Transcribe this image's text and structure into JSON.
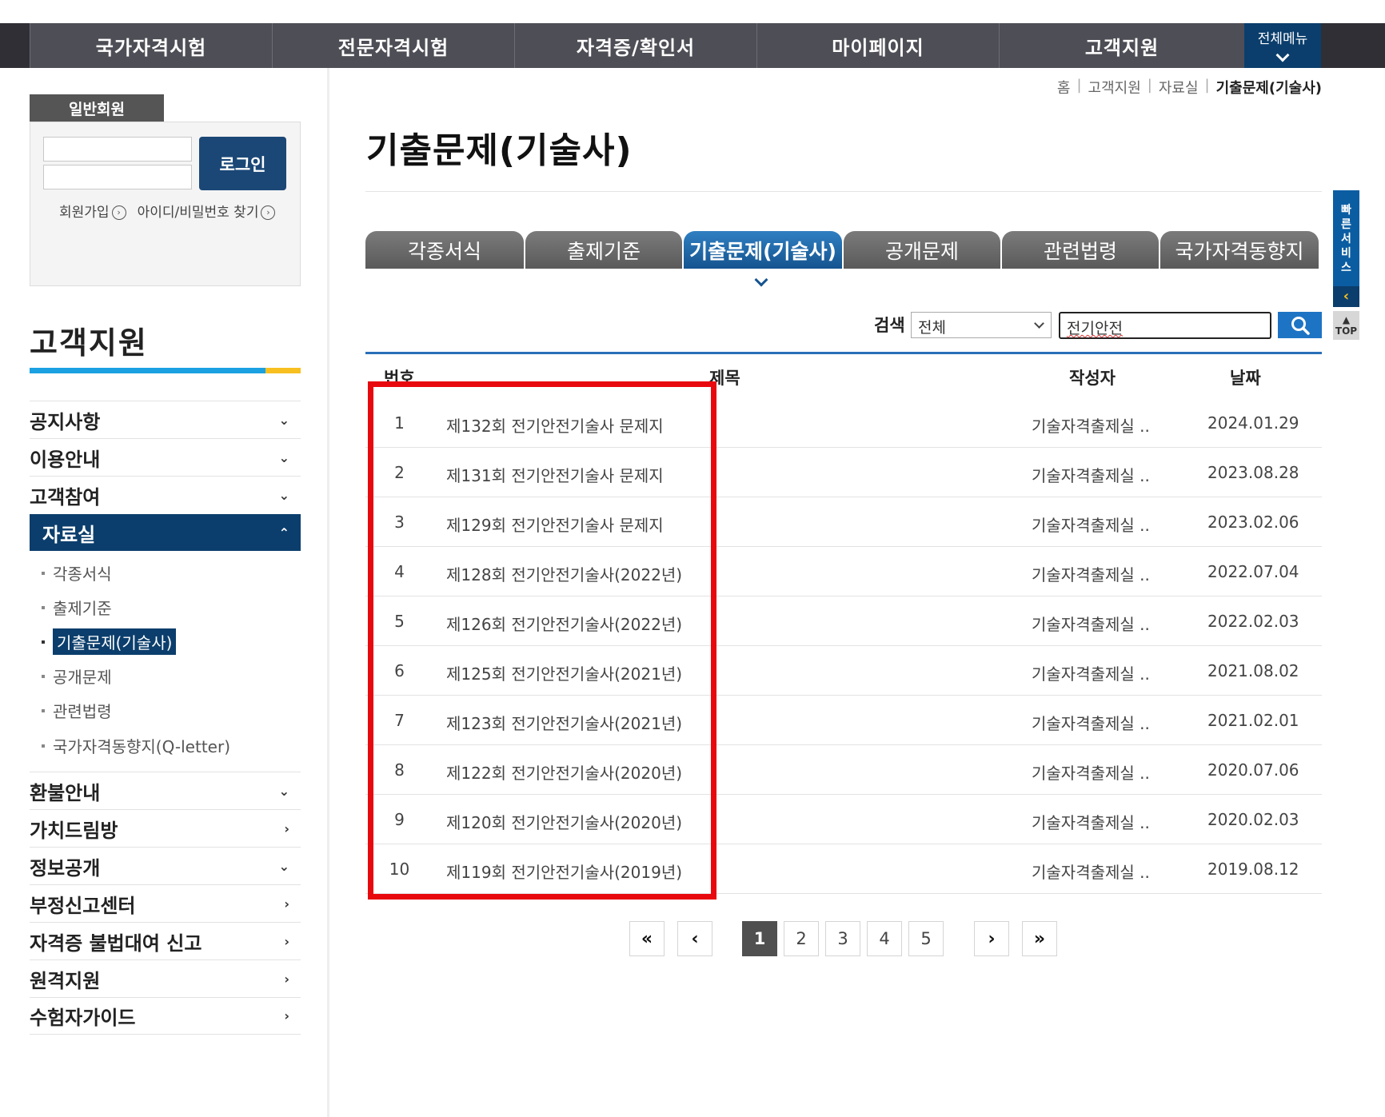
{
  "topnav": {
    "items": [
      "국가자격시험",
      "전문자격시험",
      "자격증/확인서",
      "마이페이지",
      "고객지원"
    ],
    "all_menu": "전체메뉴"
  },
  "login": {
    "member_tab": "일반회원",
    "button": "로그인",
    "links": [
      "회원가입",
      "아이디/비밀번호 찾기"
    ]
  },
  "sidebar": {
    "title": "고객지원",
    "menu": [
      {
        "label": "공지사항",
        "arrow": "down"
      },
      {
        "label": "이용안내",
        "arrow": "down"
      },
      {
        "label": "고객참여",
        "arrow": "down"
      },
      {
        "label": "자료실",
        "arrow": "up"
      },
      {
        "label": "환불안내",
        "arrow": "down"
      },
      {
        "label": "가치드림방",
        "arrow": "right"
      },
      {
        "label": "정보공개",
        "arrow": "down"
      },
      {
        "label": "부정신고센터",
        "arrow": "right"
      },
      {
        "label": "자격증 불법대여 신고",
        "arrow": "right"
      },
      {
        "label": "원격지원",
        "arrow": "right"
      },
      {
        "label": "수험자가이드",
        "arrow": "right"
      }
    ],
    "submenu": [
      "각종서식",
      "출제기준",
      "기출문제(기술사)",
      "공개문제",
      "관련법령",
      "국가자격동향지(Q-letter)"
    ]
  },
  "breadcrumb": [
    "홈",
    "고객지원",
    "자료실",
    "기출문제(기술사)"
  ],
  "page_title": "기출문제(기술사)",
  "tabs": [
    "각종서식",
    "출제기준",
    "기출문제(기술사)",
    "공개문제",
    "관련법령",
    "국가자격동향지"
  ],
  "search": {
    "label": "검색",
    "select_value": "전체",
    "input_value": "전기안전"
  },
  "quick": {
    "label": [
      "빠",
      "른",
      "서",
      "비",
      "스"
    ],
    "top": "TOP"
  },
  "table": {
    "headers": [
      "번호",
      "제목",
      "작성자",
      "날짜"
    ],
    "rows": [
      {
        "no": "1",
        "title": "제132회 전기안전기술사 문제지",
        "author": "기술자격출제실 ..",
        "date": "2024.01.29"
      },
      {
        "no": "2",
        "title": "제131회 전기안전기술사 문제지",
        "author": "기술자격출제실 ..",
        "date": "2023.08.28"
      },
      {
        "no": "3",
        "title": "제129회 전기안전기술사 문제지",
        "author": "기술자격출제실 ..",
        "date": "2023.02.06"
      },
      {
        "no": "4",
        "title": "제128회 전기안전기술사(2022년)",
        "author": "기술자격출제실 ..",
        "date": "2022.07.04"
      },
      {
        "no": "5",
        "title": "제126회 전기안전기술사(2022년)",
        "author": "기술자격출제실 ..",
        "date": "2022.02.03"
      },
      {
        "no": "6",
        "title": "제125회 전기안전기술사(2021년)",
        "author": "기술자격출제실 ..",
        "date": "2021.08.02"
      },
      {
        "no": "7",
        "title": "제123회 전기안전기술사(2021년)",
        "author": "기술자격출제실 ..",
        "date": "2021.02.01"
      },
      {
        "no": "8",
        "title": "제122회 전기안전기술사(2020년)",
        "author": "기술자격출제실 ..",
        "date": "2020.07.06"
      },
      {
        "no": "9",
        "title": "제120회 전기안전기술사(2020년)",
        "author": "기술자격출제실 ..",
        "date": "2020.02.03"
      },
      {
        "no": "10",
        "title": "제119회 전기안전기술사(2019년)",
        "author": "기술자격출제실 ..",
        "date": "2019.08.12"
      }
    ]
  },
  "pagination": {
    "first": "«",
    "prev": "‹",
    "pages": [
      "1",
      "2",
      "3",
      "4",
      "5"
    ],
    "current": "1",
    "next": "›",
    "last": "»"
  }
}
